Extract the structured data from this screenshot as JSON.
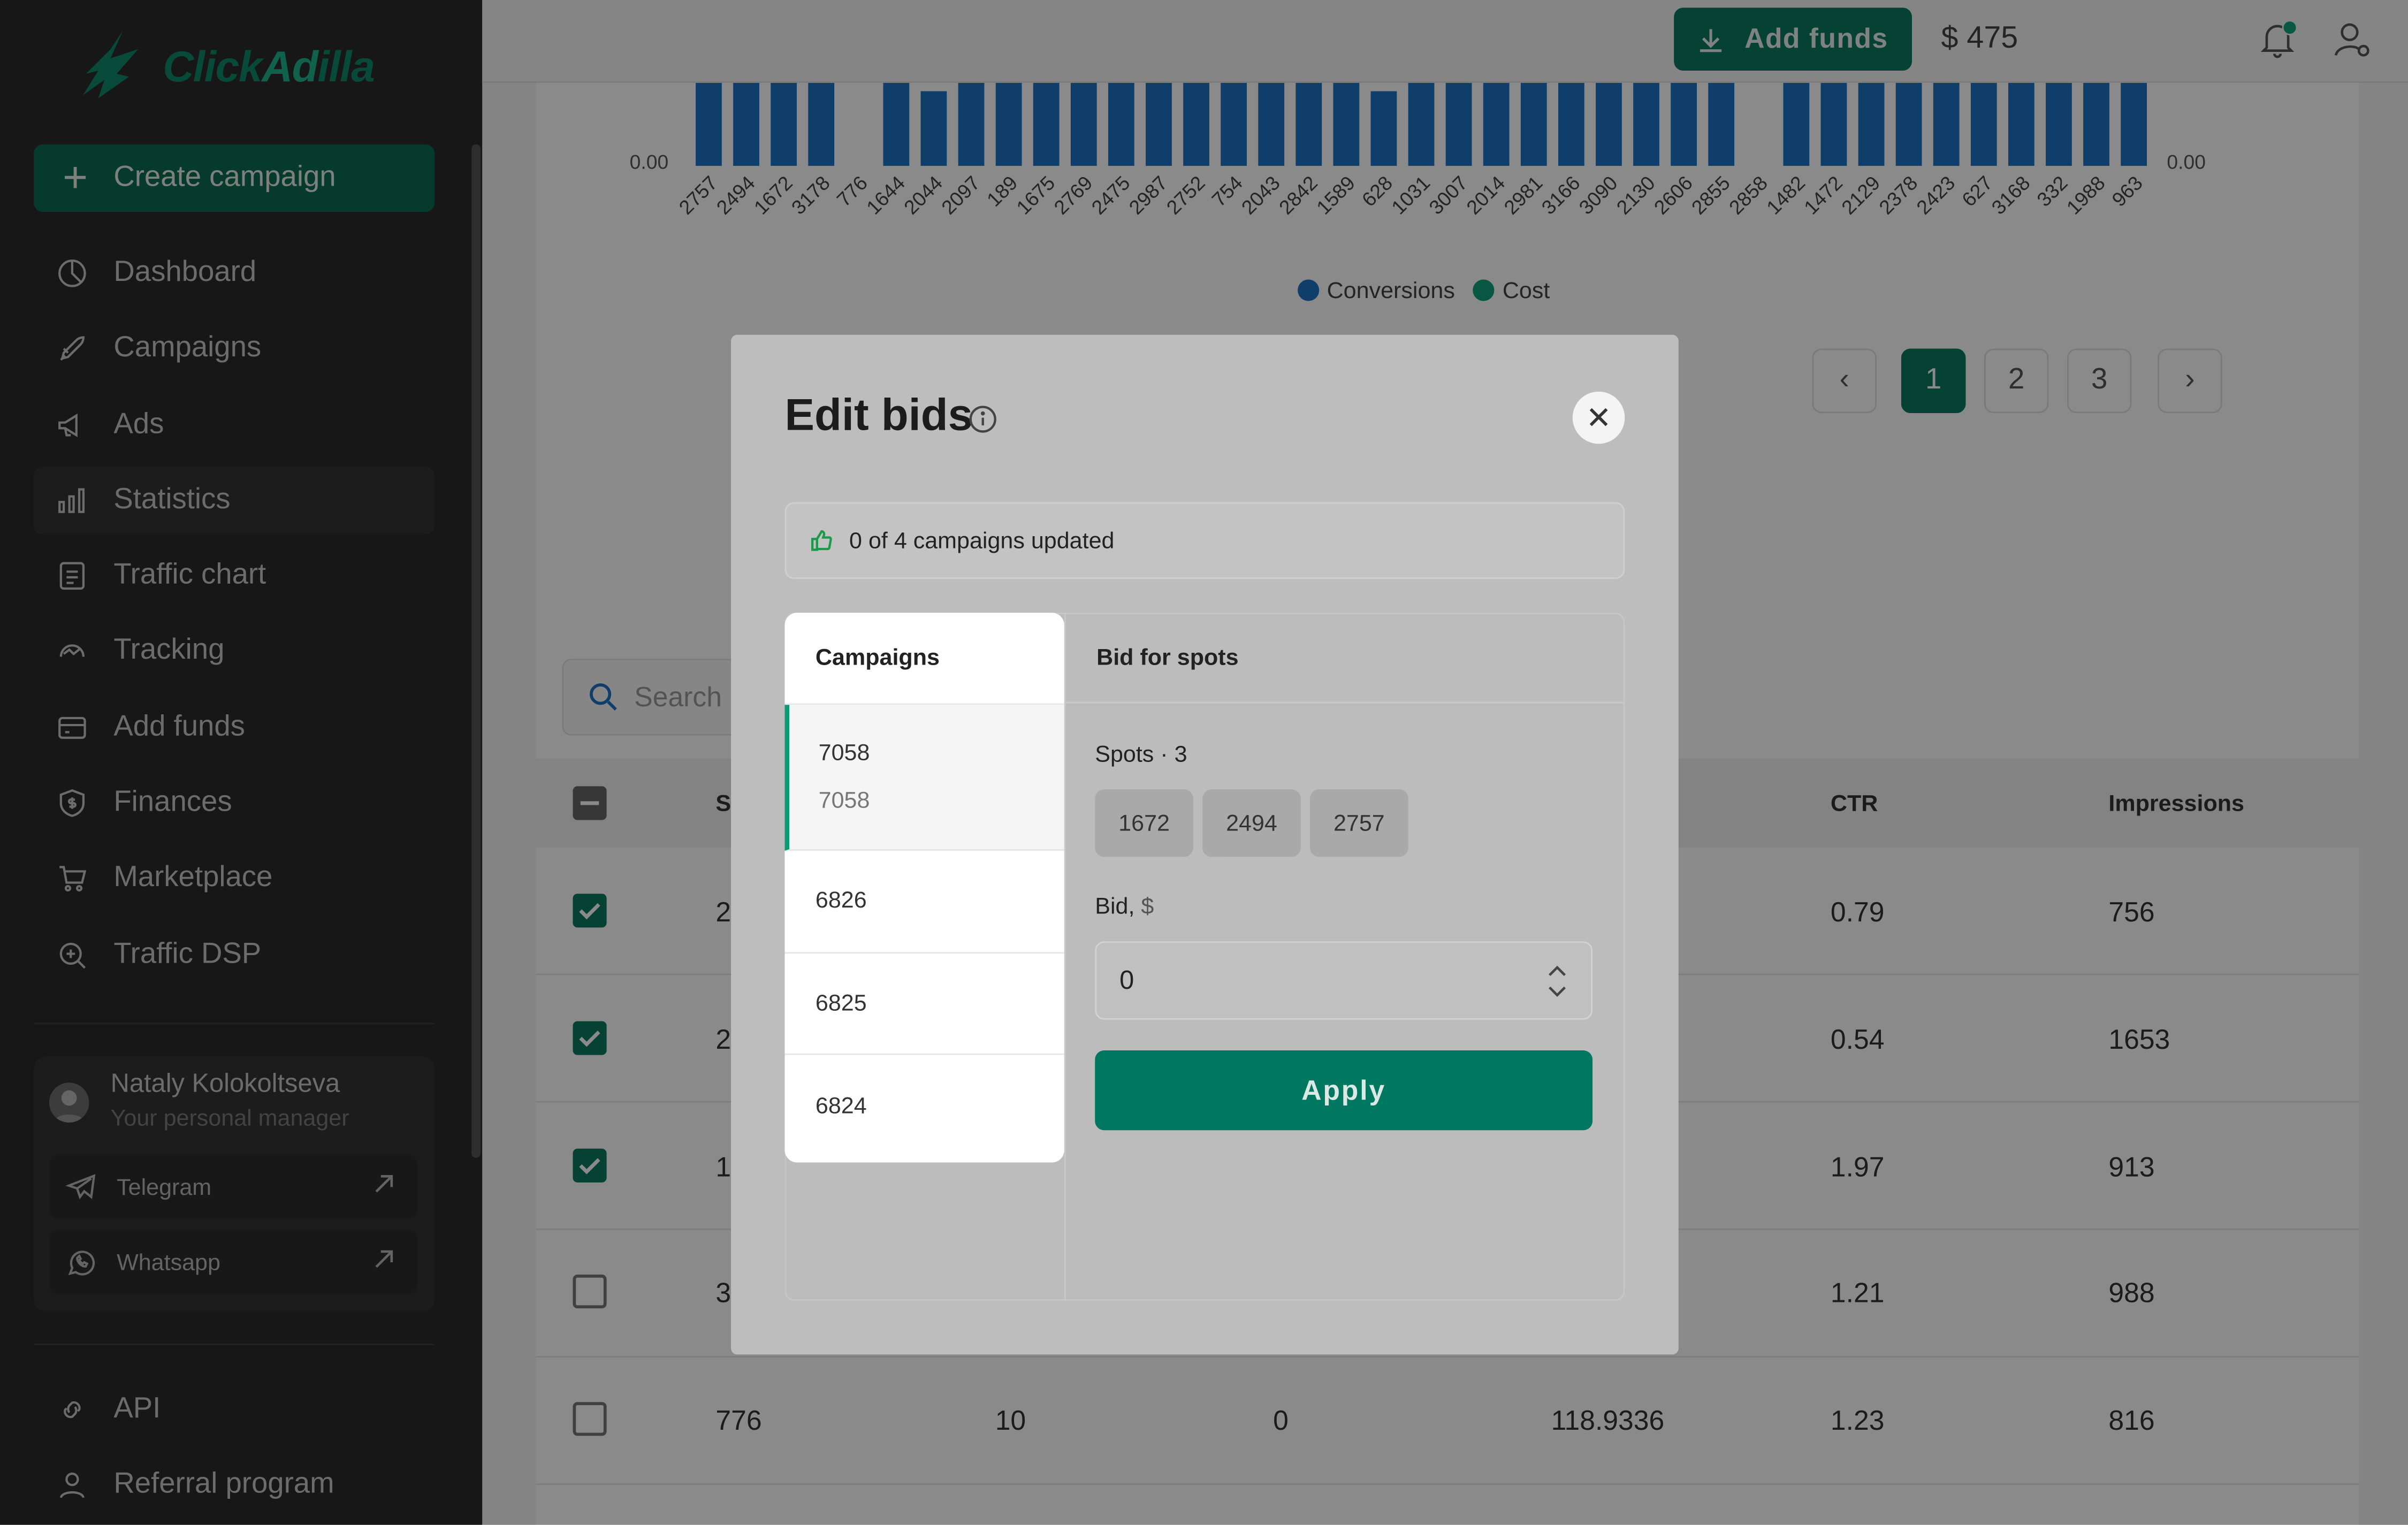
{
  "app": {
    "brand_left": "Click",
    "brand_mid": "Ad",
    "brand_right": "illa"
  },
  "sidebar": {
    "create_label": "Create campaign",
    "items": [
      {
        "label": "Dashboard",
        "icon": "pie-chart-icon"
      },
      {
        "label": "Campaigns",
        "icon": "rocket-icon"
      },
      {
        "label": "Ads",
        "icon": "megaphone-icon"
      },
      {
        "label": "Statistics",
        "icon": "bar-chart-icon",
        "active": true
      },
      {
        "label": "Traffic chart",
        "icon": "document-icon"
      },
      {
        "label": "Tracking",
        "icon": "tracking-icon"
      },
      {
        "label": "Add funds",
        "icon": "wallet-icon"
      },
      {
        "label": "Finances",
        "icon": "shield-dollar-icon"
      },
      {
        "label": "Marketplace",
        "icon": "cart-icon"
      },
      {
        "label": "Traffic DSP",
        "icon": "dsp-icon"
      }
    ],
    "manager": {
      "name": "Nataly Kolokoltseva",
      "role": "Your personal manager",
      "telegram": "Telegram",
      "whatsapp": "Whatsapp"
    },
    "bottom": [
      {
        "label": "API",
        "icon": "link-icon"
      },
      {
        "label": "Referral program",
        "icon": "person-icon"
      }
    ]
  },
  "topbar": {
    "add_funds": "Add funds",
    "balance": "$ 475"
  },
  "chart_data": {
    "type": "bar",
    "categories": [
      "2757",
      "2494",
      "1672",
      "3178",
      "776",
      "1644",
      "2044",
      "2097",
      "189",
      "1675",
      "2769",
      "2475",
      "2987",
      "2752",
      "754",
      "2043",
      "2842",
      "1589",
      "628",
      "1031",
      "3007",
      "2014",
      "2981",
      "3166",
      "3090",
      "2130",
      "2606",
      "2855",
      "2858",
      "1482",
      "1472",
      "2129",
      "2378",
      "2423",
      "627",
      "3168",
      "332",
      "1988",
      "963"
    ],
    "series": [
      {
        "name": "Conversions",
        "color": "#1f74c4",
        "values": [
          1,
          1,
          1,
          1,
          0,
          1,
          0.9,
          1,
          1,
          1,
          1,
          1,
          1,
          1,
          1,
          1,
          1,
          1,
          0.9,
          1,
          1,
          1,
          1,
          1,
          1,
          1,
          1,
          1,
          0,
          1,
          1,
          1,
          1,
          1,
          1,
          1,
          1,
          1,
          1
        ]
      },
      {
        "name": "Cost",
        "color": "#0ea17a",
        "values": []
      }
    ],
    "y_left_label": "0.00",
    "y_right_label": "0.00"
  },
  "pagination": {
    "pages": [
      "1",
      "2",
      "3"
    ],
    "active": "1"
  },
  "table": {
    "search_placeholder": "Search",
    "headers": {
      "first": "S",
      "ctr": "CTR",
      "impressions": "Impressions"
    },
    "rows": [
      {
        "checked": true,
        "c1": "2",
        "ctr": "0.79",
        "impr": "756"
      },
      {
        "checked": true,
        "c1": "2",
        "ctr": "0.54",
        "impr": "1653"
      },
      {
        "checked": true,
        "c1": "1",
        "ctr": "1.97",
        "impr": "913"
      },
      {
        "checked": false,
        "c1": "3",
        "ctr": "1.21",
        "impr": "988"
      },
      {
        "checked": false,
        "c1": "776",
        "c2": "10",
        "c3": "0",
        "c4": "118.9336",
        "ctr": "1.23",
        "impr": "816"
      }
    ]
  },
  "modal": {
    "title": "Edit bids",
    "status": "0 of 4 campaigns updated",
    "campaigns_header": "Campaigns",
    "campaigns": [
      {
        "id": "7058",
        "sub": "7058"
      },
      {
        "id": "6826"
      },
      {
        "id": "6825"
      },
      {
        "id": "6824"
      }
    ],
    "bid_header": "Bid for spots",
    "spots_label": "Spots · 3",
    "spots": [
      "1672",
      "2494",
      "2757"
    ],
    "bid_label": "Bid, ",
    "bid_unit": "$",
    "bid_value": "0",
    "apply": "Apply"
  }
}
